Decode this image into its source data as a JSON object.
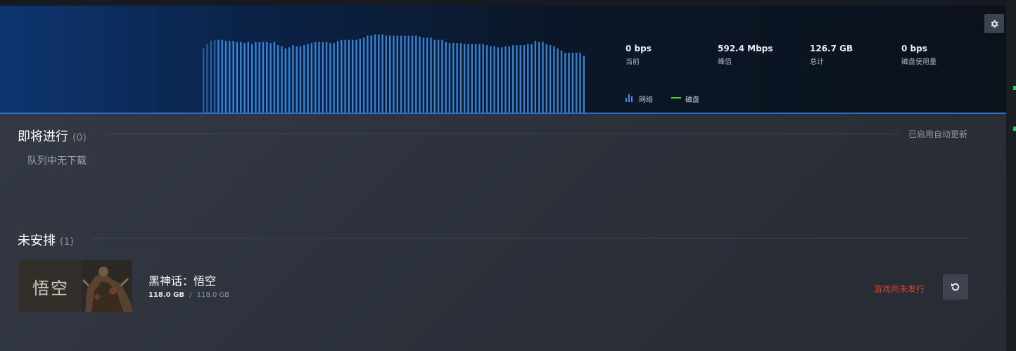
{
  "header": {
    "stats": [
      {
        "value": "0 bps",
        "label": "当前"
      },
      {
        "value": "592.4 Mbps",
        "label": "峰值"
      },
      {
        "value": "126.7 GB",
        "label": "总计"
      },
      {
        "value": "0 bps",
        "label": "磁盘使用量"
      }
    ],
    "legend": {
      "network": "网络",
      "disk": "磁盘"
    },
    "settings_icon": "gear-icon",
    "colors": {
      "network": "#3a8ee6",
      "disk": "#5ccf3d"
    }
  },
  "chart_data": {
    "type": "bar",
    "title": "",
    "xlabel": "",
    "ylabel": "",
    "ylim": [
      0,
      100
    ],
    "series": [
      {
        "values": [
          60,
          64,
          67,
          68,
          68,
          68,
          67,
          67,
          67,
          66,
          66,
          65,
          66,
          64,
          66,
          66,
          66,
          66,
          65,
          66,
          63,
          62,
          60,
          61,
          63,
          62,
          62,
          63,
          64,
          65,
          66,
          66,
          66,
          66,
          65,
          65,
          67,
          68,
          68,
          68,
          68,
          68,
          69,
          70,
          72,
          72,
          73,
          73,
          73,
          72,
          72,
          72,
          72,
          72,
          72,
          72,
          72,
          72,
          71,
          70,
          70,
          70,
          68,
          68,
          68,
          66,
          65,
          65,
          65,
          65,
          64,
          64,
          64,
          64,
          64,
          64,
          63,
          62,
          62,
          61,
          61,
          62,
          62,
          63,
          63,
          63,
          63,
          64,
          64,
          67,
          66,
          66,
          64,
          63,
          62,
          60,
          58,
          56,
          56,
          56,
          56,
          56,
          53
        ]
      }
    ]
  },
  "upcoming": {
    "title": "即将进行",
    "count": "(0)",
    "auto_update": "已启用自动更新",
    "empty_text": "队列中无下载"
  },
  "unscheduled": {
    "title": "未安排",
    "count": "(1)",
    "items": [
      {
        "name": "黑神话：悟空",
        "size_done": "118.0 GB",
        "separator": "/",
        "size_total": "118.0 GB",
        "status": "游戏尚未发行",
        "thumb_text": "悟空",
        "action_icon": "restore-icon"
      }
    ]
  }
}
